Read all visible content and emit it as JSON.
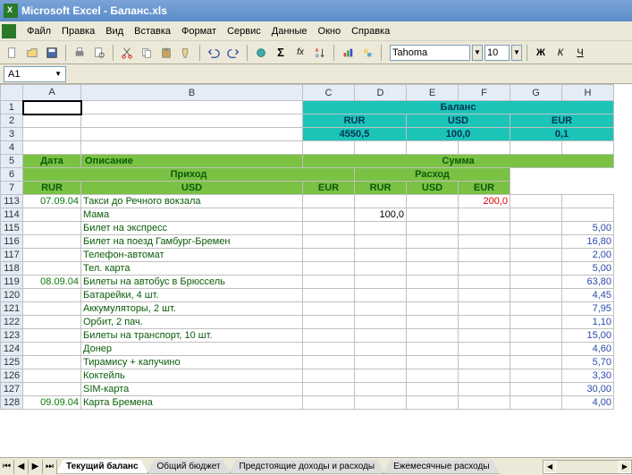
{
  "title": "Microsoft Excel - Баланс.xls",
  "menus": [
    "Файл",
    "Правка",
    "Вид",
    "Вставка",
    "Формат",
    "Сервис",
    "Данные",
    "Окно",
    "Справка"
  ],
  "font": {
    "name": "Tahoma",
    "size": "10"
  },
  "style_btns": {
    "bold": "Ж",
    "italic": "К",
    "underline": "Ч"
  },
  "namebox": "A1",
  "cols": [
    "A",
    "B",
    "C",
    "D",
    "E",
    "F",
    "G",
    "H"
  ],
  "widths": [
    "colA",
    "colB",
    "colC",
    "colD",
    "colE",
    "colF",
    "colG",
    "colH"
  ],
  "balance": {
    "header": "Баланс",
    "currencies": [
      "RUR",
      "USD",
      "EUR"
    ],
    "values": [
      "4550,5",
      "100,0",
      "0,1"
    ]
  },
  "sumhdr": {
    "date": "Дата",
    "desc": "Описание",
    "sum": "Сумма",
    "income": "Приход",
    "expense": "Расход",
    "rur": "RUR",
    "usd": "USD",
    "eur": "EUR"
  },
  "rows": [
    {
      "n": "1"
    },
    {
      "n": "2"
    },
    {
      "n": "3"
    },
    {
      "n": "4"
    },
    {
      "n": "5"
    },
    {
      "n": "6"
    },
    {
      "n": "7"
    },
    {
      "n": "113",
      "date": "07.09.04",
      "desc": "Такси до Речного вокзала",
      "exp_rur": "200,0"
    },
    {
      "n": "114",
      "desc": "Мама",
      "inc_usd": "100,0"
    },
    {
      "n": "115",
      "desc": "Билет на экспресс",
      "exp_eur": "5,00"
    },
    {
      "n": "116",
      "desc": "Билет на поезд Гамбург-Бремен",
      "exp_eur": "16,80"
    },
    {
      "n": "117",
      "desc": "Телефон-автомат",
      "exp_eur": "2,00"
    },
    {
      "n": "118",
      "desc": "Тел. карта",
      "exp_eur": "5,00"
    },
    {
      "n": "119",
      "date": "08.09.04",
      "desc": "Билеты на автобус в Брюссель",
      "exp_eur": "63,80"
    },
    {
      "n": "120",
      "desc": "Батарейки, 4 шт.",
      "exp_eur": "4,45"
    },
    {
      "n": "121",
      "desc": "Аккумуляторы, 2 шт.",
      "exp_eur": "7,95"
    },
    {
      "n": "122",
      "desc": "Орбит, 2 пач.",
      "exp_eur": "1,10"
    },
    {
      "n": "123",
      "desc": "Билеты на транспорт, 10 шт.",
      "exp_eur": "15,00"
    },
    {
      "n": "124",
      "desc": "Донер",
      "exp_eur": "4,60"
    },
    {
      "n": "125",
      "desc": "Тирамису + капучино",
      "exp_eur": "5,70"
    },
    {
      "n": "126",
      "desc": "Коктейль",
      "exp_eur": "3,30"
    },
    {
      "n": "127",
      "desc": "SIM-карта",
      "exp_eur": "30,00"
    },
    {
      "n": "128",
      "date": "09.09.04",
      "desc": "Карта Бремена",
      "exp_eur": "4,00"
    }
  ],
  "tabs": [
    "Текущий баланс",
    "Общий бюджет",
    "Предстоящие доходы и расходы",
    "Ежемесячные расходы"
  ],
  "active_tab": 0
}
